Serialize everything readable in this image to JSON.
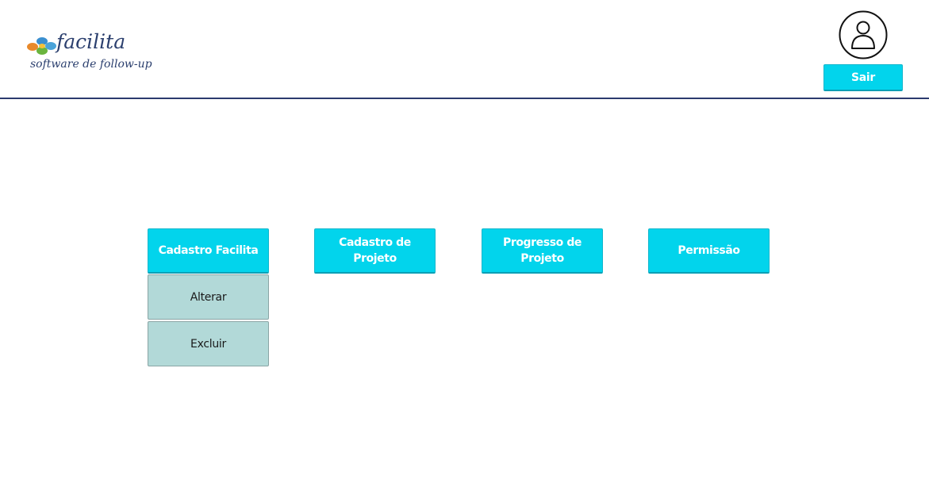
{
  "header": {
    "logo": {
      "name": "facilita",
      "tagline": "software de follow-up"
    },
    "user_icon": "user-circle-icon",
    "logout_label": "Sair"
  },
  "menu": {
    "items": [
      {
        "label": "Cadastro Facilita",
        "submenu": [
          {
            "label": "Alterar"
          },
          {
            "label": "Excluir"
          }
        ]
      },
      {
        "label": "Cadastro de Projeto"
      },
      {
        "label": "Progresso de Projeto"
      },
      {
        "label": "Permissão"
      }
    ]
  },
  "colors": {
    "primary_button": "#02d4ec",
    "submenu_button": "#b2d9d8",
    "divider": "#2b3a6e",
    "logo_text": "#2b3f6e"
  }
}
